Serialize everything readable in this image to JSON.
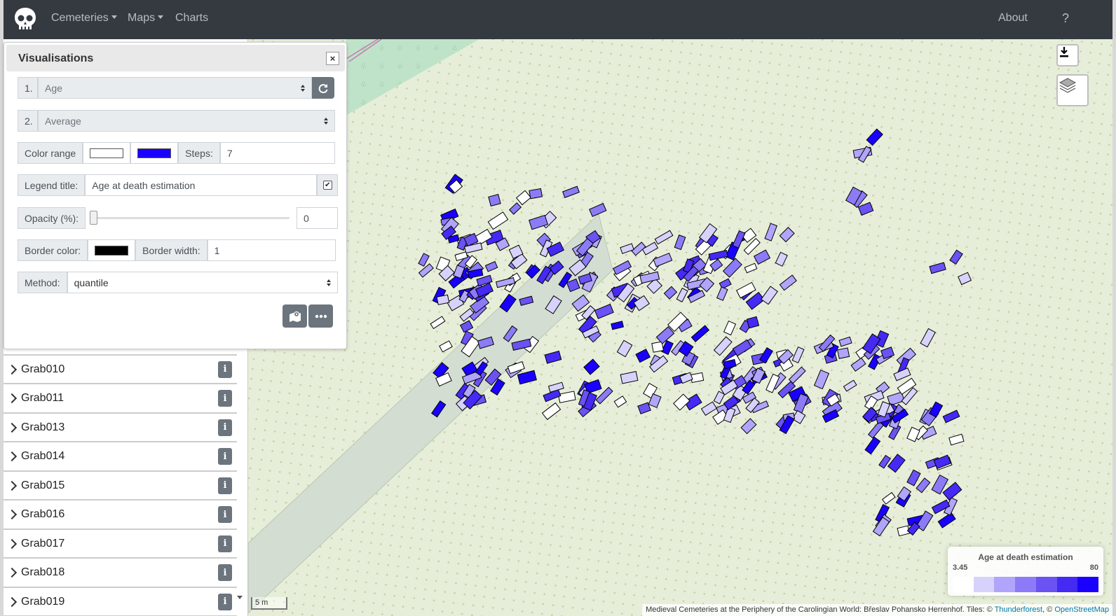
{
  "navbar": {
    "menu": [
      {
        "label": "Cemeteries",
        "dropdown": true
      },
      {
        "label": "Maps",
        "dropdown": true
      },
      {
        "label": "Charts",
        "dropdown": false
      }
    ],
    "about_label": "About",
    "help_label": "?",
    "logo_icon": "skull-icon"
  },
  "panel": {
    "title": "Visualisations",
    "close_label": "×",
    "row1": {
      "prefix": "1.",
      "value": "Age"
    },
    "row2": {
      "prefix": "2.",
      "value": "Average"
    },
    "color_range": {
      "label": "Color range",
      "from": "#ffffff",
      "to": "#1a00ff",
      "steps_label": "Steps:",
      "steps_value": "7"
    },
    "legend_title": {
      "label": "Legend title:",
      "value": "Age at death estimation",
      "checked": true
    },
    "opacity": {
      "label": "Opacity (%):",
      "value": "0",
      "level_percent": 0
    },
    "border": {
      "color_label": "Border color:",
      "color": "#000000",
      "width_label": "Border width:",
      "width_value": "1"
    },
    "method": {
      "label": "Method:",
      "value": "quantile"
    },
    "icons": [
      "refresh-icon",
      "map-marker-icon",
      "more-icon"
    ]
  },
  "sidebar": {
    "items": [
      {
        "label": "Grab010"
      },
      {
        "label": "Grab011"
      },
      {
        "label": "Grab013"
      },
      {
        "label": "Grab014"
      },
      {
        "label": "Grab015"
      },
      {
        "label": "Grab016"
      },
      {
        "label": "Grab017"
      },
      {
        "label": "Grab018"
      },
      {
        "label": "Grab019"
      }
    ]
  },
  "map": {
    "scale_label": "5 m",
    "attribution_text": "Medieval Cemeteries at the Periphery of the Carolingian World: Břeslav Pohansko Herrenhof. Tiles: © ",
    "attribution_link1": "Thunderforest",
    "attribution_sep": ", © ",
    "attribution_link2": "OpenStreetMap",
    "legend": {
      "title": "Age at death estimation",
      "min": "3.45",
      "max": "80",
      "colors": [
        "#ffffff",
        "#d7d2fc",
        "#b0a5fa",
        "#8c7bf6",
        "#6a52f3",
        "#442af3",
        "#1a00ff"
      ]
    }
  }
}
